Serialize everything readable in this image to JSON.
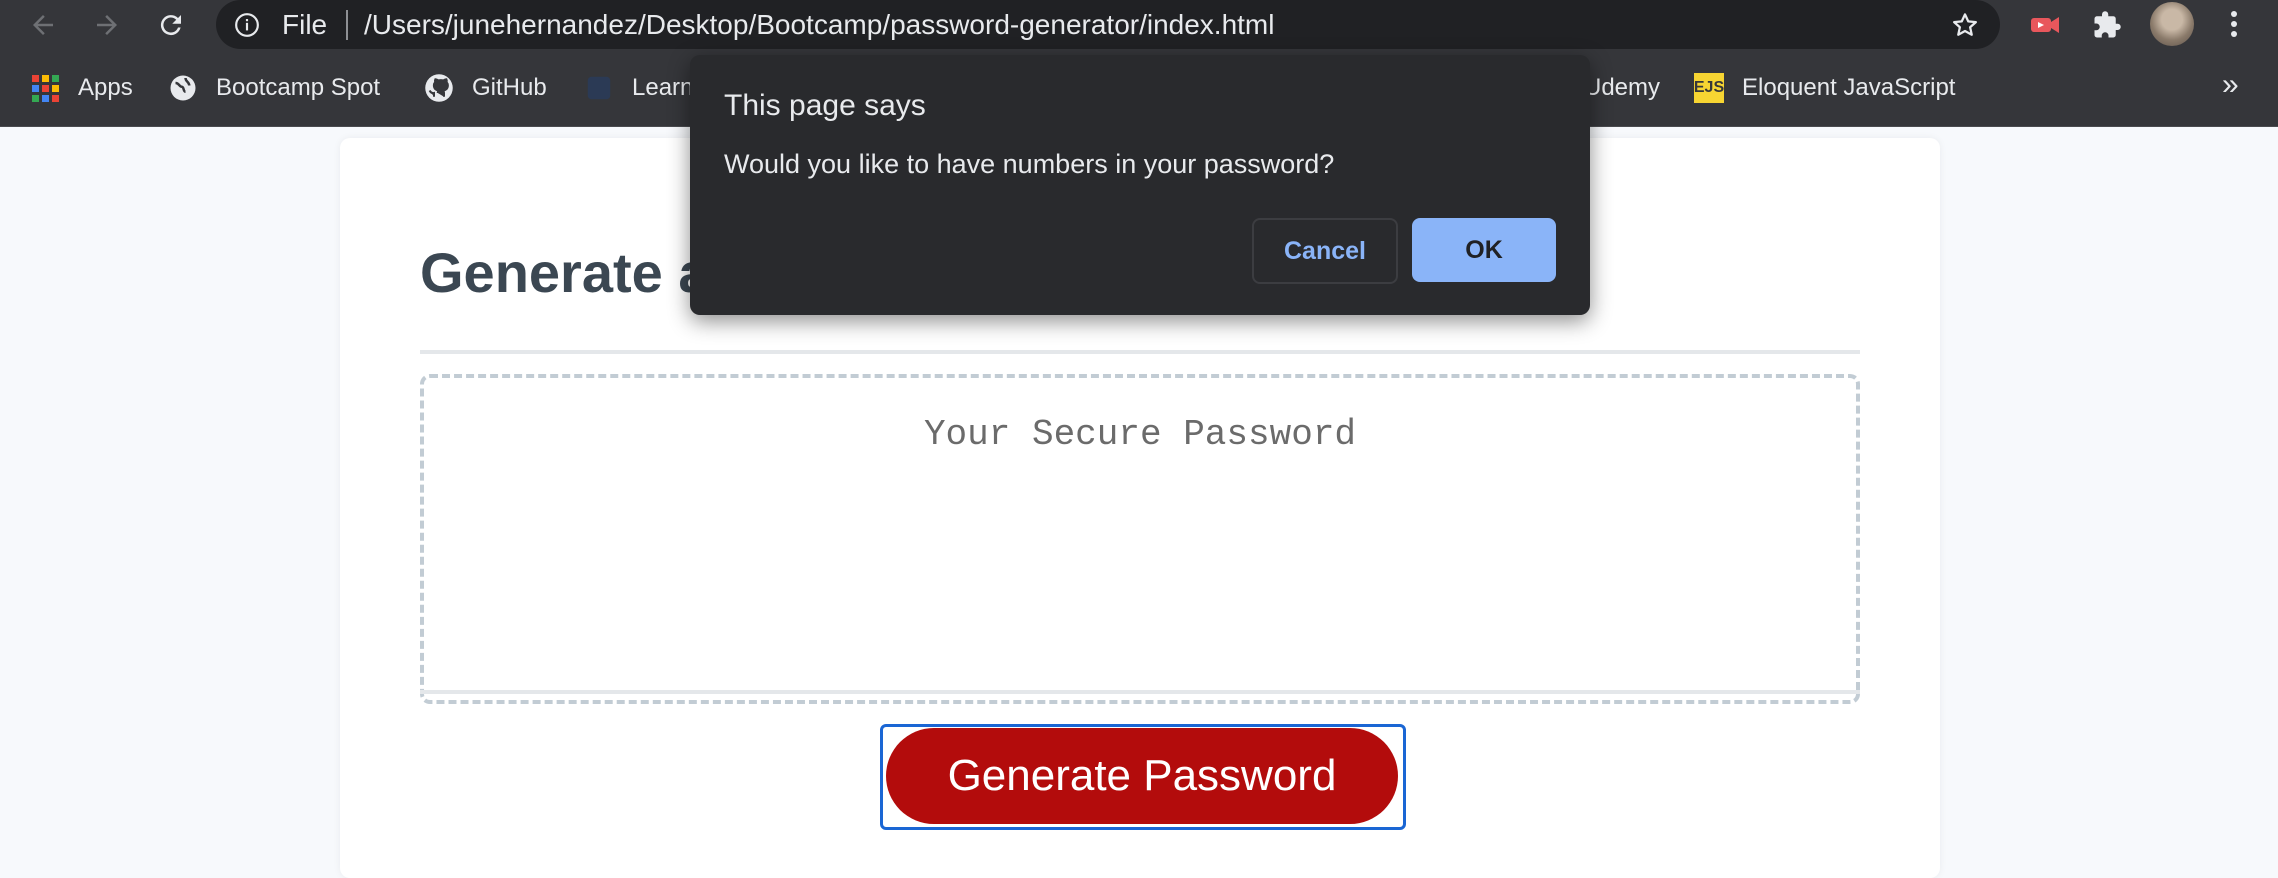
{
  "browser": {
    "omnibox": {
      "scheme_label": "File",
      "url": "/Users/junehernandez/Desktop/Bootcamp/password-generator/index.html"
    },
    "bookmarks": [
      {
        "label": "Apps",
        "icon": "apps-grid-icon"
      },
      {
        "label": "Bootcamp Spot",
        "icon": "globe-icon"
      },
      {
        "label": "GitHub",
        "icon": "github-icon"
      },
      {
        "label": "Learn",
        "icon": "learn-icon"
      },
      {
        "label": "Udemy",
        "icon": "udemy-icon"
      },
      {
        "label": "Eloquent JavaScript",
        "icon": "ejs-icon",
        "badge": "EJS"
      }
    ],
    "overflow_label": "»"
  },
  "page": {
    "title": "Generate a",
    "password_placeholder": "Your Secure Password",
    "generate_button": "Generate Password"
  },
  "dialog": {
    "title": "This page says",
    "message": "Would you like to have numbers in your password?",
    "cancel_label": "Cancel",
    "ok_label": "OK"
  },
  "colors": {
    "toolbar": "#35363a",
    "omnibox": "#202124",
    "dialog_bg": "#292a2d",
    "dialog_accent": "#8ab4f8",
    "generate_button": "#b30c0c",
    "focus_ring": "#1a66d4",
    "page_bg": "#f7f9fc"
  }
}
